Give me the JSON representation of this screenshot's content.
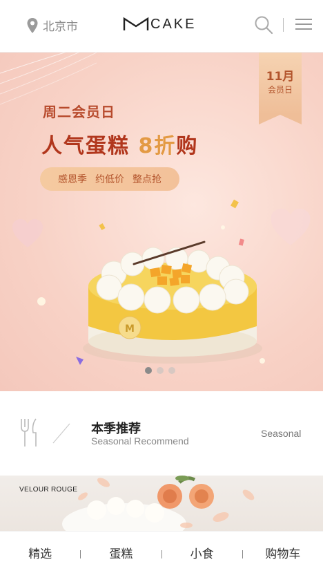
{
  "header": {
    "location": "北京市",
    "location_icon": "location-pin-icon",
    "logo_text": "CAKE",
    "search_icon": "search-icon",
    "menu_icon": "menu-icon"
  },
  "banner": {
    "ribbon_month": "11月",
    "ribbon_sub": "会员日",
    "subtitle": "周二会员日",
    "title_part1": "人气蛋糕",
    "title_highlight": "8折",
    "title_part2": "购",
    "pill_items": [
      "感恩季",
      "约低价",
      "整点抢"
    ],
    "carousel_total": 3,
    "carousel_active": 0
  },
  "seasonal": {
    "title": "本季推荐",
    "subtitle": "Seasonal Recommend",
    "link_label": "Seasonal"
  },
  "product": {
    "brand": "VELOUR ROUGE"
  },
  "nav": {
    "items": [
      "精选",
      "蛋糕",
      "小食",
      "购物车"
    ]
  }
}
